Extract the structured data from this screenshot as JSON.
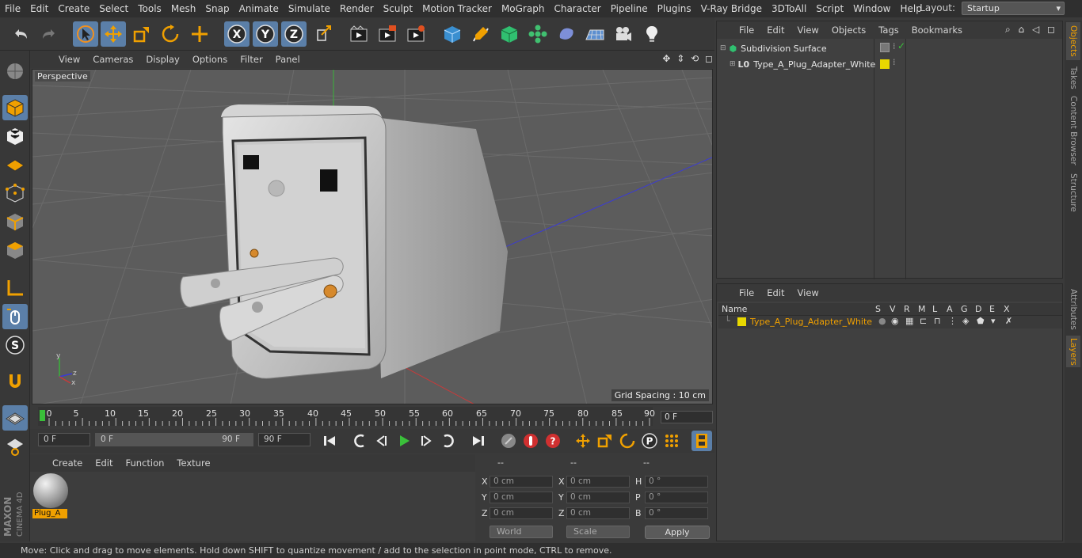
{
  "menubar": {
    "items": [
      "File",
      "Edit",
      "Create",
      "Select",
      "Tools",
      "Mesh",
      "Snap",
      "Animate",
      "Simulate",
      "Render",
      "Sculpt",
      "Motion Tracker",
      "MoGraph",
      "Character",
      "Pipeline",
      "Plugins",
      "V-Ray Bridge",
      "3DToAll",
      "Script",
      "Window",
      "Help"
    ],
    "layout_label": "Layout:",
    "layout_value": "Startup"
  },
  "toolbar": {
    "icons": [
      "undo-icon",
      "redo-icon",
      "live-select-icon",
      "move-icon",
      "scale-icon",
      "rotate-icon",
      "create-icon",
      "x-axis-icon",
      "y-axis-icon",
      "z-axis-icon",
      "world-coordinate-icon",
      "render-view-icon",
      "render-picture-viewer-icon",
      "edit-render-settings-icon",
      "cube-icon",
      "pen-icon",
      "subdivision-icon",
      "cloner-icon",
      "deformer-icon",
      "floor-icon",
      "camera-icon",
      "light-icon"
    ]
  },
  "viewport": {
    "menu": [
      "View",
      "Cameras",
      "Display",
      "Options",
      "Filter",
      "Panel"
    ],
    "label": "Perspective",
    "grid_spacing": "Grid Spacing : 10 cm"
  },
  "timeline": {
    "ticks": [
      "0",
      "5",
      "10",
      "15",
      "20",
      "25",
      "30",
      "35",
      "40",
      "45",
      "50",
      "55",
      "60",
      "65",
      "70",
      "75",
      "80",
      "85",
      "90"
    ],
    "current_frame": "0 F"
  },
  "transport": {
    "start_field": "0 F",
    "range_start": "0 F",
    "range_end": "90 F",
    "end_field": "90 F"
  },
  "materials": {
    "menu": [
      "Create",
      "Edit",
      "Function",
      "Texture"
    ],
    "items": [
      {
        "name": "Plug_A"
      }
    ]
  },
  "coordinates": {
    "headers": [
      "--",
      "--",
      "--"
    ],
    "rows": [
      {
        "l1": "X",
        "v1": "0 cm",
        "l2": "X",
        "v2": "0 cm",
        "l3": "H",
        "v3": "0 °"
      },
      {
        "l1": "Y",
        "v1": "0 cm",
        "l2": "Y",
        "v2": "0 cm",
        "l3": "P",
        "v3": "0 °"
      },
      {
        "l1": "Z",
        "v1": "0 cm",
        "l2": "Z",
        "v2": "0 cm",
        "l3": "B",
        "v3": "0 °"
      }
    ],
    "mode_world": "World",
    "mode_scale": "Scale",
    "apply": "Apply"
  },
  "objects": {
    "menu": [
      "File",
      "Edit",
      "View",
      "Objects",
      "Tags",
      "Bookmarks"
    ],
    "tree": [
      {
        "name": "Subdivision Surface"
      },
      {
        "name": "Type_A_Plug_Adapter_White"
      }
    ]
  },
  "layers": {
    "menu": [
      "File",
      "Edit",
      "View"
    ],
    "columns": {
      "name": "Name",
      "flags": [
        "S",
        "V",
        "R",
        "M",
        "L",
        "A",
        "G",
        "D",
        "E",
        "X"
      ]
    },
    "rows": [
      {
        "name": "Type_A_Plug_Adapter_White",
        "color": "#e8d800"
      }
    ]
  },
  "sidetabs": [
    "Objects",
    "Takes",
    "Content Browser",
    "Structure",
    "Attributes",
    "Layers"
  ],
  "status": "Move: Click and drag to move elements. Hold down SHIFT to quantize movement / add to the selection in point mode, CTRL to remove.",
  "brand": {
    "line1": "MAXON",
    "line2": "CINEMA 4D"
  },
  "colors": {
    "accent_selected": "#5b7fa8",
    "highlight_orange": "#f0a000",
    "layer_yellow": "#e8d800"
  }
}
